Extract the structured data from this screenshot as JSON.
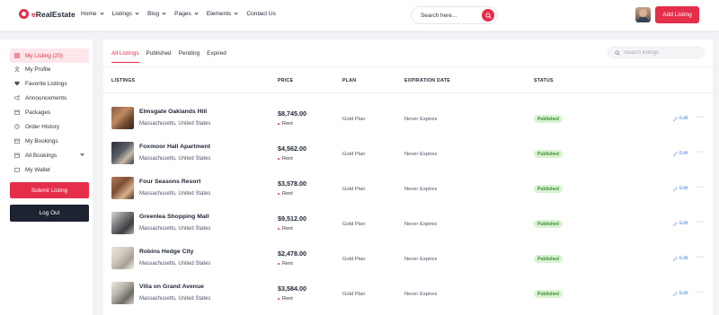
{
  "app": {
    "logo": {
      "prefix": "e",
      "name": "RealEstate"
    }
  },
  "nav": {
    "items": [
      {
        "label": "Home",
        "dropdown": true
      },
      {
        "label": "Listings",
        "dropdown": true
      },
      {
        "label": "Blog",
        "dropdown": true
      },
      {
        "label": "Pages",
        "dropdown": true
      },
      {
        "label": "Elements",
        "dropdown": true
      },
      {
        "label": "Contact Us",
        "dropdown": false
      }
    ],
    "search_placeholder": "Search here...",
    "add_listing_label": "Add Listing"
  },
  "sidebar": {
    "items": [
      {
        "label": "My Listing (20)",
        "icon": "list-icon",
        "active": true
      },
      {
        "label": "My Profile",
        "icon": "user-icon",
        "active": false
      },
      {
        "label": "Favorite Listings",
        "icon": "heart-icon",
        "active": false
      },
      {
        "label": "Announcements",
        "icon": "megaphone-icon",
        "active": false
      },
      {
        "label": "Packages",
        "icon": "package-icon",
        "active": false
      },
      {
        "label": "Order History",
        "icon": "history-icon",
        "active": false
      },
      {
        "label": "My Bookings",
        "icon": "calendar-icon",
        "active": false
      },
      {
        "label": "All Bookings",
        "icon": "calendar-icon",
        "active": false,
        "expandable": true
      },
      {
        "label": "My Wallet",
        "icon": "wallet-icon",
        "active": false
      }
    ],
    "submit_label": "Submit Listing",
    "logout_label": "Log Out"
  },
  "main": {
    "tabs": [
      {
        "label": "All Listings",
        "active": true
      },
      {
        "label": "Published",
        "active": false
      },
      {
        "label": "Pending",
        "active": false
      },
      {
        "label": "Expired",
        "active": false
      }
    ],
    "search_placeholder": "Search listings",
    "columns": {
      "listings": "LISTINGS",
      "price": "PRICE",
      "plan": "PLAN",
      "expiration": "EXPIRATION DATE",
      "status": "STATUS"
    },
    "edit_label": "Edit",
    "more_label": "···",
    "rows": [
      {
        "name": "Elmsgate Oaklands Hill",
        "location": "Massachusetts, United States",
        "price": "$8,745.00",
        "type": "Rent",
        "plan": "Gold Plan",
        "expiration": "Never Expires",
        "status": "Published",
        "thumb": "interior"
      },
      {
        "name": "Foxmoor Hall Apartment",
        "location": "Massachusetts, United States",
        "price": "$4,562.00",
        "type": "Rent",
        "plan": "Gold Plan",
        "expiration": "Never Expires",
        "status": "Published",
        "thumb": "dark"
      },
      {
        "name": "Four Seasons Resort",
        "location": "Massachusetts, United States",
        "price": "$3,578.00",
        "type": "Rent",
        "plan": "Gold Plan",
        "expiration": "Never Expires",
        "status": "Published",
        "thumb": "warm"
      },
      {
        "name": "Greenlea Shopping Mall",
        "location": "Massachusetts, United States",
        "price": "$9,512.00",
        "type": "Rent",
        "plan": "Gold Plan",
        "expiration": "Never Expires",
        "status": "Published",
        "thumb": "hall"
      },
      {
        "name": "Robins Hedge City",
        "location": "Massachusetts, United States",
        "price": "$2,478.00",
        "type": "Rent",
        "plan": "Gold Plan",
        "expiration": "Never Expires",
        "status": "Published",
        "thumb": "light"
      },
      {
        "name": "Villa on Grand Avenue",
        "location": "Massachusetts, United States",
        "price": "$3,584.00",
        "type": "Rent",
        "plan": "Gold Plan",
        "expiration": "Never Expires",
        "status": "Published",
        "thumb": "living"
      }
    ]
  },
  "colors": {
    "accent": "#e52e4a",
    "dark": "#1d2331",
    "status_bg": "#d8f2d2",
    "status_text": "#3c8f31",
    "link": "#4a8cf0"
  }
}
